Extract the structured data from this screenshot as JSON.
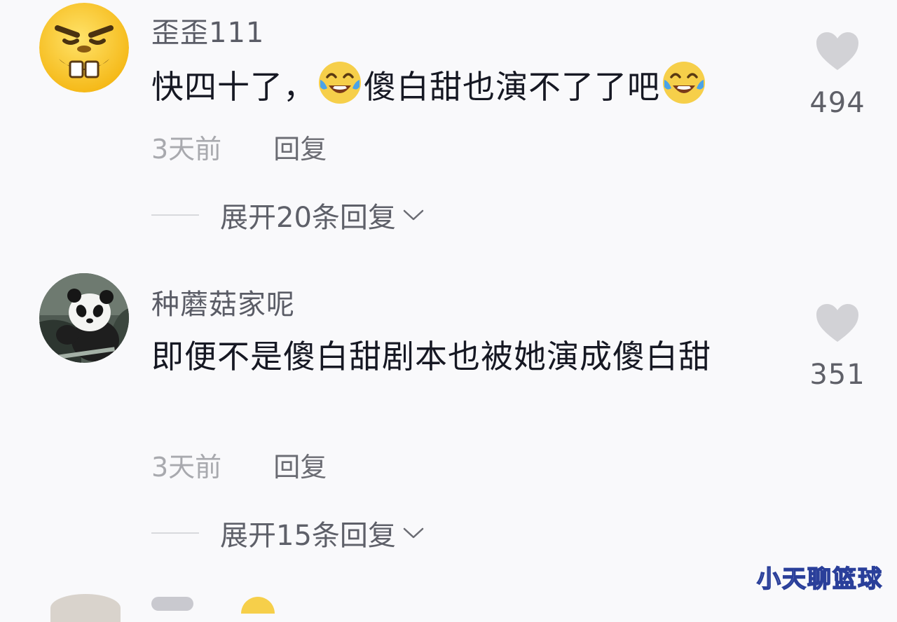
{
  "comments": [
    {
      "username": "歪歪111",
      "avatar_icon": "grinning-buck-teeth-emoji-avatar",
      "text_before": "快四十了，",
      "emoji_1": "laugh-cry-emoji",
      "text_middle": "傻白甜也演不了了吧",
      "emoji_2": "laugh-cry-emoji",
      "time": "3天前",
      "reply_label": "回复",
      "like_count": "494",
      "expand_label": "展开20条回复"
    },
    {
      "username": "种蘑菇家呢",
      "avatar_icon": "panda-photo-avatar",
      "text": "即便不是傻白甜剧本也被她演成傻白甜",
      "time": "3天前",
      "reply_label": "回复",
      "like_count": "351",
      "expand_label": "展开15条回复"
    }
  ],
  "watermark": "小天聊篮球",
  "colors": {
    "background": "#f9f9fb",
    "text": "#161823",
    "secondary_text": "#8a8b92",
    "heart": "#d2d2d6",
    "emoji_yellow": "#f6cf4a"
  }
}
